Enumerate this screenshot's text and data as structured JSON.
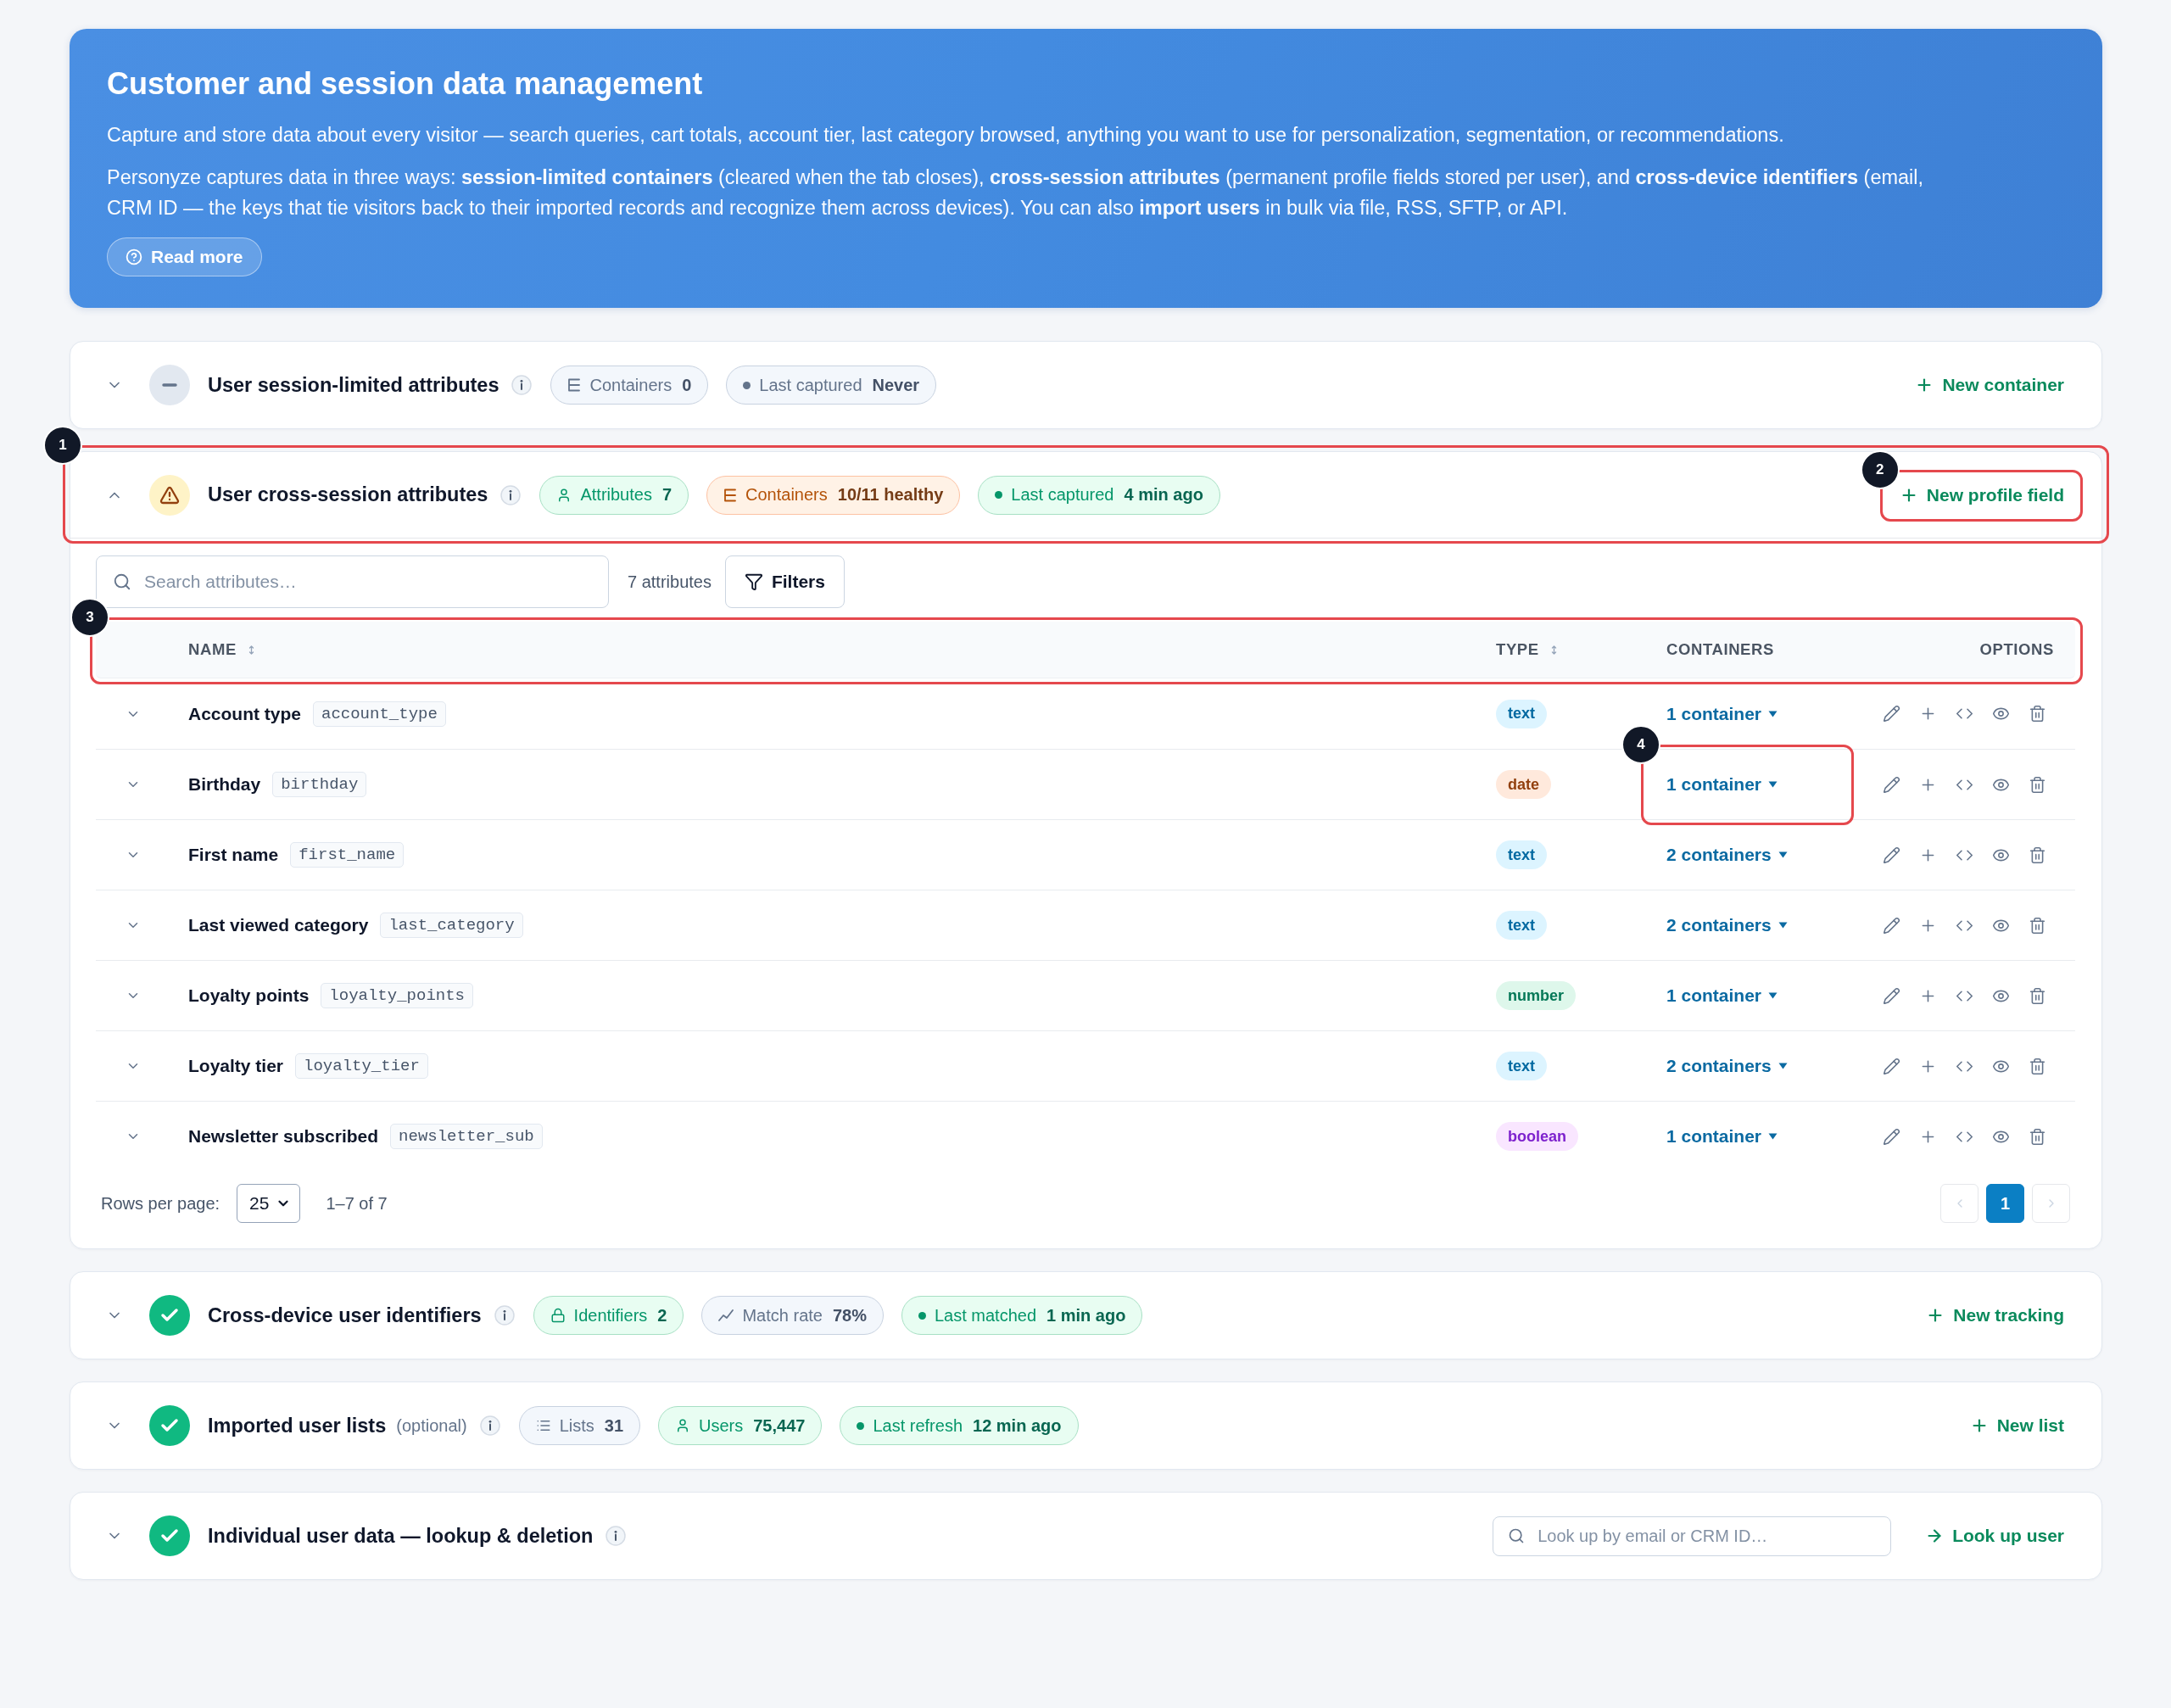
{
  "banner": {
    "title": "Customer and session data management",
    "paragraphs": [
      "Capture and store data about every visitor — search queries, cart totals, account tier, last category browsed, anything you want to use for personalization, segmentation, or recommendations.",
      "Personyze captures data in three ways: **session-limited containers** (cleared when the tab closes), **cross-session attributes** (permanent profile fields stored per user), and **cross-device identifiers** (email, CRM ID — the keys that tie visitors back to their imported records and recognize them across devices). You can also **import users** in bulk via file, RSS, SFTP, or API."
    ],
    "button": "Read more"
  },
  "sections": [
    {
      "title": "User session-limited attributes",
      "kind": "empty",
      "expanded": false,
      "badges": [
        {
          "kind": "containers",
          "label": "Containers",
          "value": "0",
          "color": "#64748b"
        },
        {
          "kind": "last_captured",
          "label": "Last captured",
          "value": "Never",
          "color": "#64748b"
        }
      ],
      "action": {
        "kind": "create",
        "label": "New container"
      }
    },
    {
      "title": "User cross-session attributes",
      "kind": "warning",
      "expanded": true,
      "callout": "1",
      "badges": [
        {
          "kind": "attributes",
          "label": "Attributes",
          "value": "7",
          "color": "#059669"
        },
        {
          "kind": "containers",
          "label": "Containers",
          "value": "10/11 healthy",
          "color": "#b45309"
        },
        {
          "kind": "last_captured",
          "label": "Last captured",
          "value": "4 min ago",
          "color": "#059669"
        }
      ],
      "action": {
        "kind": "create",
        "label": "New profile field",
        "callout": "2"
      },
      "toolbar": {
        "search_placeholder": "Search attributes…",
        "count": "7 attributes",
        "filter_button": "Filters"
      },
      "table": {
        "callout": "3",
        "columns": [
          {
            "label": "NAME",
            "sortable": true
          },
          {
            "label": "TYPE",
            "sortable": true
          },
          {
            "label": "CONTAINERS",
            "sortable": false
          },
          {
            "label": "OPTIONS",
            "sortable": false
          }
        ],
        "rows": [
          {
            "name": "Account type",
            "key": "account_type",
            "type": "text",
            "color": "#0369a1",
            "containers": "1 container",
            "expanded": false
          },
          {
            "name": "Birthday",
            "key": "birthday",
            "type": "date",
            "color": "#92400e",
            "containers": "1 container",
            "expanded": false,
            "containers_callout": "4"
          },
          {
            "name": "First name",
            "key": "first_name",
            "type": "text",
            "color": "#0369a1",
            "containers": "2 containers",
            "expanded": false
          },
          {
            "name": "Last viewed category",
            "key": "last_category",
            "type": "text",
            "color": "#0369a1",
            "containers": "2 containers",
            "expanded": false
          },
          {
            "name": "Loyalty points",
            "key": "loyalty_points",
            "type": "number",
            "color": "#047857",
            "containers": "1 container",
            "expanded": false
          },
          {
            "name": "Loyalty tier",
            "key": "loyalty_tier",
            "type": "text",
            "color": "#0369a1",
            "containers": "2 containers",
            "expanded": false
          },
          {
            "name": "Newsletter subscribed",
            "key": "newsletter_sub",
            "type": "boolean",
            "color": "#7e22ce",
            "containers": "1 container",
            "expanded": false
          }
        ]
      },
      "pagination": {
        "label": "Rows per page:",
        "rows_per_page": "25",
        "range": "1–7 of 7",
        "previous": {
          "disabled": true
        },
        "pages": [
          {
            "label": "1",
            "selected": true
          }
        ],
        "next": {
          "disabled": true
        }
      }
    },
    {
      "title": "Cross-device user identifiers",
      "kind": "healthy",
      "expanded": false,
      "badges": [
        {
          "kind": "identifiers",
          "label": "Identifiers",
          "value": "2",
          "color": "#059669"
        },
        {
          "kind": "match_rate",
          "label": "Match rate",
          "value": "78%",
          "color": "#64748b"
        },
        {
          "kind": "last_matched",
          "label": "Last matched",
          "value": "1 min ago",
          "color": "#059669"
        }
      ],
      "action": {
        "kind": "create",
        "label": "New tracking"
      }
    },
    {
      "title": "Imported user lists",
      "note": "(optional)",
      "kind": "healthy",
      "expanded": false,
      "badges": [
        {
          "kind": "lists",
          "label": "Lists",
          "value": "31",
          "color": "#64748b"
        },
        {
          "kind": "users",
          "label": "Users",
          "value": "75,447",
          "color": "#059669"
        },
        {
          "kind": "last_refresh",
          "label": "Last refresh",
          "value": "12 min ago",
          "color": "#059669"
        }
      ],
      "action": {
        "kind": "create",
        "label": "New list"
      }
    },
    {
      "title": "Individual user data — lookup & deletion",
      "kind": "healthy",
      "expanded": false,
      "lookup_placeholder": "Look up by email or CRM ID…",
      "action": {
        "kind": "lookup",
        "label": "Look up user"
      }
    }
  ]
}
